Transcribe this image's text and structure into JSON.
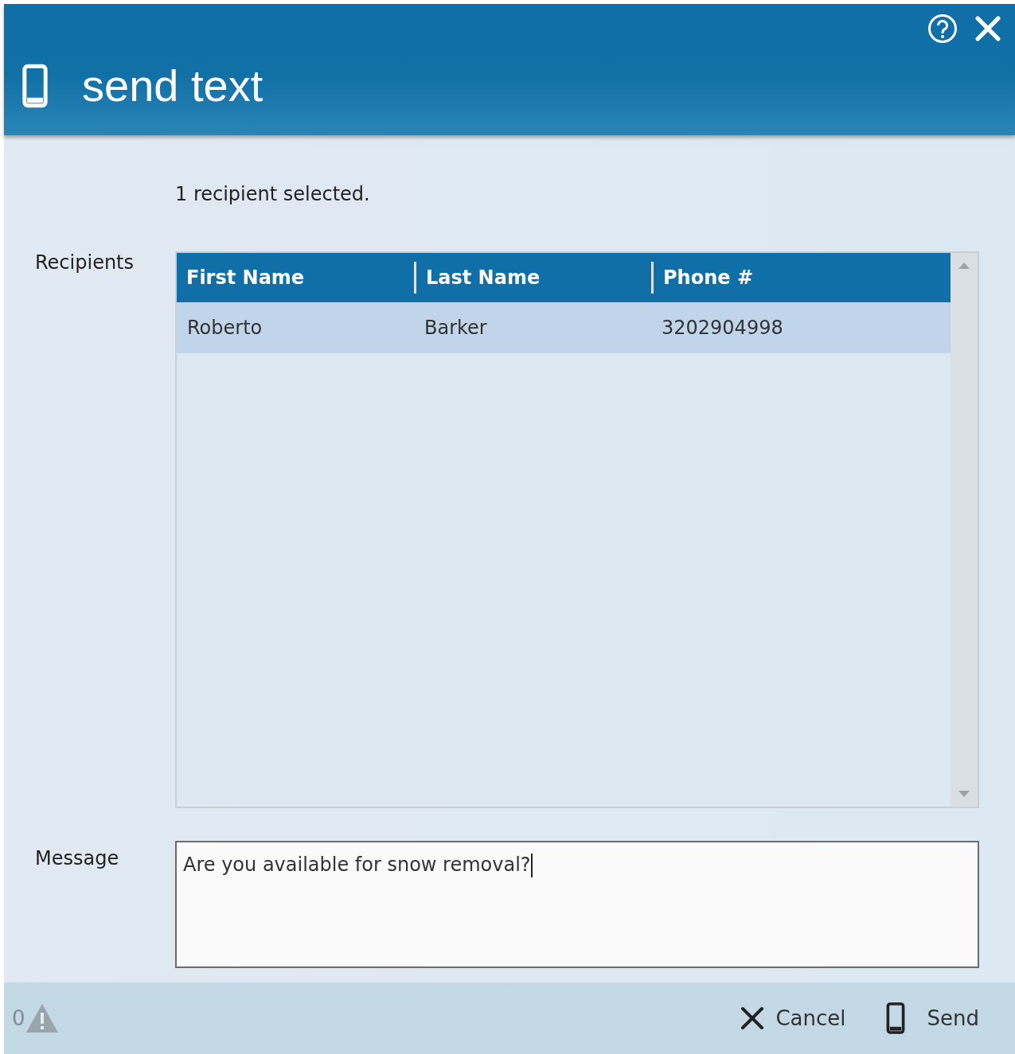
{
  "window": {
    "title": "send text"
  },
  "summary": "1 recipient selected.",
  "recipients": {
    "label": "Recipients",
    "columns": [
      "First Name",
      "Last Name",
      "Phone #"
    ],
    "rows": [
      {
        "cells": [
          "Roberto",
          "Barker",
          "3202904998"
        ],
        "selected": true
      }
    ]
  },
  "message": {
    "label": "Message",
    "value": "Are you available for snow removal?"
  },
  "status": {
    "warnings": "0"
  },
  "buttons": [
    {
      "kind": "cancel",
      "label": "Cancel"
    },
    {
      "kind": "send",
      "label": "Send"
    }
  ]
}
